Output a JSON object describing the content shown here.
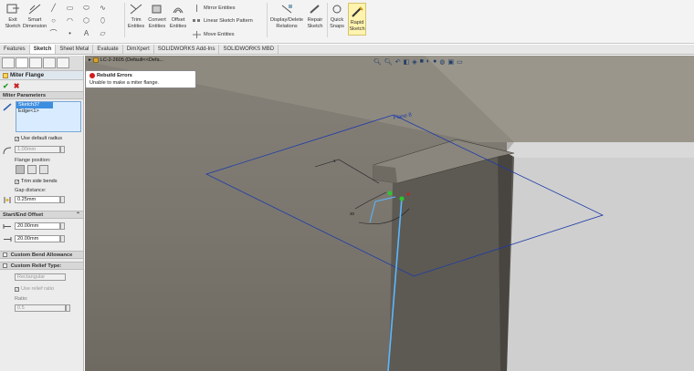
{
  "ribbon": {
    "exit_sketch": "Exit Sketch",
    "smart_dimension": "Smart Dimension",
    "trim_entities": "Trim Entities",
    "convert_entities": "Convert Entities",
    "offset_entities": "Offset Entities",
    "mirror_entities": "Mirror Entities",
    "linear_sketch_pattern": "Linear Sketch Pattern",
    "move_entities": "Move Entities",
    "display_delete_relations": "Display/Delete Relations",
    "repair_sketch": "Repair Sketch",
    "quick_snaps": "Quick Snaps",
    "rapid_sketch": "Rapid Sketch"
  },
  "tabs": [
    "Features",
    "Sketch",
    "Sheet Metal",
    "Evaluate",
    "DimXpert",
    "SOLIDWORKS Add-Ins",
    "SOLIDWORKS MBD"
  ],
  "tree": {
    "part_name": "LC-2-2605 (Default<<Defa..."
  },
  "tooltip": {
    "title": "Rebuild Errors",
    "message": "Unable to make a miter flange."
  },
  "property_manager": {
    "title": "Miter Flange",
    "miter_parameters": {
      "heading": "Miter Parameters",
      "selections": [
        "Sketch37",
        "Edge<1>"
      ],
      "use_default_radius": "Use default radius",
      "radius": "1.00mm",
      "flange_position_label": "Flange position:",
      "trim_side_bends": "Trim side bends",
      "gap_distance_label": "Gap distance:",
      "gap_distance": "0.25mm"
    },
    "start_end_offset": {
      "heading": "Start/End Offset",
      "start": "20.00mm",
      "end": "20.00mm"
    },
    "custom_bend_allowance": {
      "heading": "Custom Bend Allowance"
    },
    "custom_relief_type": {
      "heading": "Custom Relief Type:",
      "type": "Rectangular",
      "use_relief_ratio": "Use relief ratio",
      "ratio_label": "Ratio:",
      "ratio": "0.5"
    }
  },
  "plane_label": "Plane 8",
  "colors": {
    "accent": "#3d8ee0",
    "error": "#d21d1d",
    "sketch_blue": "#1c3aa8",
    "selection_cyan": "#5bb8ff",
    "ok_green": "#2d9a2d"
  }
}
